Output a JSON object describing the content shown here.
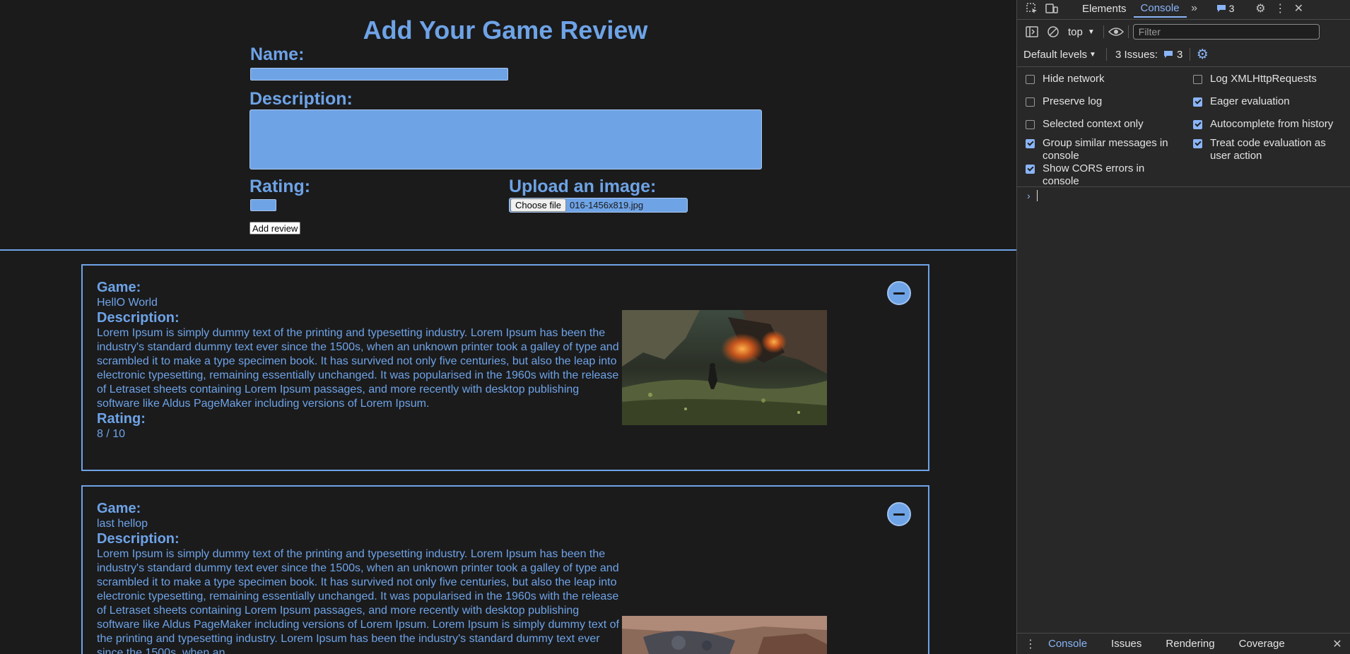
{
  "form": {
    "title": "Add Your Game Review",
    "name_label": "Name:",
    "description_label": "Description:",
    "rating_label": "Rating:",
    "upload_label": "Upload an image:",
    "choose_file_label": "Choose file",
    "file_name": "016-1456x819.jpg",
    "add_review_label": "Add review"
  },
  "reviews": [
    {
      "game_label": "Game:",
      "game": "HellO World",
      "description_label": "Description:",
      "description": "Lorem Ipsum is simply dummy text of the printing and typesetting industry. Lorem Ipsum has been the industry's standard dummy text ever since the 1500s, when an unknown printer took a galley of type and scrambled it to make a type specimen book. It has survived not only five centuries, but also the leap into electronic typesetting, remaining essentially unchanged. It was popularised in the 1960s with the release of Letraset sheets containing Lorem Ipsum passages, and more recently with desktop publishing software like Aldus PageMaker including versions of Lorem Ipsum.",
      "rating_label": "Rating:",
      "rating": "8 / 10"
    },
    {
      "game_label": "Game:",
      "game": "last hellop",
      "description_label": "Description:",
      "description": "Lorem Ipsum is simply dummy text of the printing and typesetting industry. Lorem Ipsum has been the industry's standard dummy text ever since the 1500s, when an unknown printer took a galley of type and scrambled it to make a type specimen book. It has survived not only five centuries, but also the leap into electronic typesetting, remaining essentially unchanged. It was popularised in the 1960s with the release of Letraset sheets containing Lorem Ipsum passages, and more recently with desktop publishing software like Aldus PageMaker including versions of Lorem Ipsum. Lorem Ipsum is simply dummy text of the printing and typesetting industry. Lorem Ipsum has been the industry's standard dummy text ever since the 1500s, when an"
    }
  ],
  "devtools": {
    "tabs": [
      "Elements",
      "Console"
    ],
    "active_tab": "Console",
    "issues_badge": "3",
    "context": "top",
    "filter_placeholder": "Filter",
    "levels": "Default levels",
    "issues_label": "3 Issues:",
    "issues_count": "3",
    "settings": [
      {
        "label": "Hide network",
        "checked": false
      },
      {
        "label": "Log XMLHttpRequests",
        "checked": false
      },
      {
        "label": "Preserve log",
        "checked": false
      },
      {
        "label": "Eager evaluation",
        "checked": true
      },
      {
        "label": "Selected context only",
        "checked": false
      },
      {
        "label": "Autocomplete from history",
        "checked": true
      },
      {
        "label": "Group similar messages in console",
        "checked": true
      },
      {
        "label": "Treat code evaluation as user action",
        "checked": true
      },
      {
        "label": "Show CORS errors in console",
        "checked": true
      }
    ],
    "bottom_tabs": [
      "Console",
      "Issues",
      "Rendering",
      "Coverage"
    ],
    "accent": "#8ab4f8"
  },
  "colors": {
    "accent": "#6ea3e6",
    "page_bg": "#1b1b1c"
  }
}
